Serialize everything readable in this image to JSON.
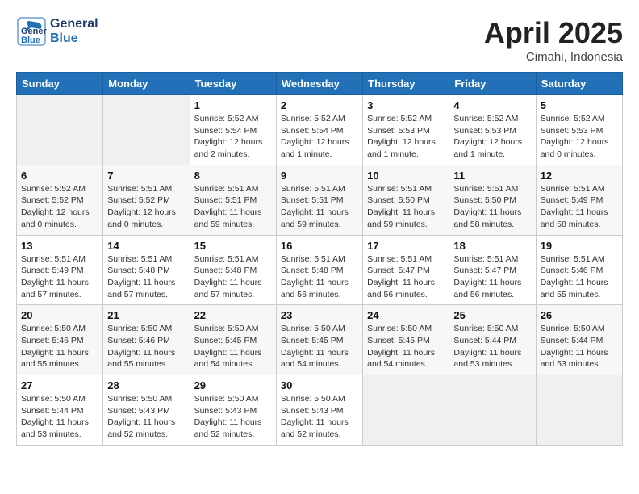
{
  "header": {
    "logo_general": "General",
    "logo_blue": "Blue",
    "month_title": "April 2025",
    "location": "Cimahi, Indonesia"
  },
  "calendar": {
    "weekdays": [
      "Sunday",
      "Monday",
      "Tuesday",
      "Wednesday",
      "Thursday",
      "Friday",
      "Saturday"
    ],
    "weeks": [
      [
        {
          "day": "",
          "info": ""
        },
        {
          "day": "",
          "info": ""
        },
        {
          "day": "1",
          "info": "Sunrise: 5:52 AM\nSunset: 5:54 PM\nDaylight: 12 hours\nand 2 minutes."
        },
        {
          "day": "2",
          "info": "Sunrise: 5:52 AM\nSunset: 5:54 PM\nDaylight: 12 hours\nand 1 minute."
        },
        {
          "day": "3",
          "info": "Sunrise: 5:52 AM\nSunset: 5:53 PM\nDaylight: 12 hours\nand 1 minute."
        },
        {
          "day": "4",
          "info": "Sunrise: 5:52 AM\nSunset: 5:53 PM\nDaylight: 12 hours\nand 1 minute."
        },
        {
          "day": "5",
          "info": "Sunrise: 5:52 AM\nSunset: 5:53 PM\nDaylight: 12 hours\nand 0 minutes."
        }
      ],
      [
        {
          "day": "6",
          "info": "Sunrise: 5:52 AM\nSunset: 5:52 PM\nDaylight: 12 hours\nand 0 minutes."
        },
        {
          "day": "7",
          "info": "Sunrise: 5:51 AM\nSunset: 5:52 PM\nDaylight: 12 hours\nand 0 minutes."
        },
        {
          "day": "8",
          "info": "Sunrise: 5:51 AM\nSunset: 5:51 PM\nDaylight: 11 hours\nand 59 minutes."
        },
        {
          "day": "9",
          "info": "Sunrise: 5:51 AM\nSunset: 5:51 PM\nDaylight: 11 hours\nand 59 minutes."
        },
        {
          "day": "10",
          "info": "Sunrise: 5:51 AM\nSunset: 5:50 PM\nDaylight: 11 hours\nand 59 minutes."
        },
        {
          "day": "11",
          "info": "Sunrise: 5:51 AM\nSunset: 5:50 PM\nDaylight: 11 hours\nand 58 minutes."
        },
        {
          "day": "12",
          "info": "Sunrise: 5:51 AM\nSunset: 5:49 PM\nDaylight: 11 hours\nand 58 minutes."
        }
      ],
      [
        {
          "day": "13",
          "info": "Sunrise: 5:51 AM\nSunset: 5:49 PM\nDaylight: 11 hours\nand 57 minutes."
        },
        {
          "day": "14",
          "info": "Sunrise: 5:51 AM\nSunset: 5:48 PM\nDaylight: 11 hours\nand 57 minutes."
        },
        {
          "day": "15",
          "info": "Sunrise: 5:51 AM\nSunset: 5:48 PM\nDaylight: 11 hours\nand 57 minutes."
        },
        {
          "day": "16",
          "info": "Sunrise: 5:51 AM\nSunset: 5:48 PM\nDaylight: 11 hours\nand 56 minutes."
        },
        {
          "day": "17",
          "info": "Sunrise: 5:51 AM\nSunset: 5:47 PM\nDaylight: 11 hours\nand 56 minutes."
        },
        {
          "day": "18",
          "info": "Sunrise: 5:51 AM\nSunset: 5:47 PM\nDaylight: 11 hours\nand 56 minutes."
        },
        {
          "day": "19",
          "info": "Sunrise: 5:51 AM\nSunset: 5:46 PM\nDaylight: 11 hours\nand 55 minutes."
        }
      ],
      [
        {
          "day": "20",
          "info": "Sunrise: 5:50 AM\nSunset: 5:46 PM\nDaylight: 11 hours\nand 55 minutes."
        },
        {
          "day": "21",
          "info": "Sunrise: 5:50 AM\nSunset: 5:46 PM\nDaylight: 11 hours\nand 55 minutes."
        },
        {
          "day": "22",
          "info": "Sunrise: 5:50 AM\nSunset: 5:45 PM\nDaylight: 11 hours\nand 54 minutes."
        },
        {
          "day": "23",
          "info": "Sunrise: 5:50 AM\nSunset: 5:45 PM\nDaylight: 11 hours\nand 54 minutes."
        },
        {
          "day": "24",
          "info": "Sunrise: 5:50 AM\nSunset: 5:45 PM\nDaylight: 11 hours\nand 54 minutes."
        },
        {
          "day": "25",
          "info": "Sunrise: 5:50 AM\nSunset: 5:44 PM\nDaylight: 11 hours\nand 53 minutes."
        },
        {
          "day": "26",
          "info": "Sunrise: 5:50 AM\nSunset: 5:44 PM\nDaylight: 11 hours\nand 53 minutes."
        }
      ],
      [
        {
          "day": "27",
          "info": "Sunrise: 5:50 AM\nSunset: 5:44 PM\nDaylight: 11 hours\nand 53 minutes."
        },
        {
          "day": "28",
          "info": "Sunrise: 5:50 AM\nSunset: 5:43 PM\nDaylight: 11 hours\nand 52 minutes."
        },
        {
          "day": "29",
          "info": "Sunrise: 5:50 AM\nSunset: 5:43 PM\nDaylight: 11 hours\nand 52 minutes."
        },
        {
          "day": "30",
          "info": "Sunrise: 5:50 AM\nSunset: 5:43 PM\nDaylight: 11 hours\nand 52 minutes."
        },
        {
          "day": "",
          "info": ""
        },
        {
          "day": "",
          "info": ""
        },
        {
          "day": "",
          "info": ""
        }
      ]
    ]
  }
}
